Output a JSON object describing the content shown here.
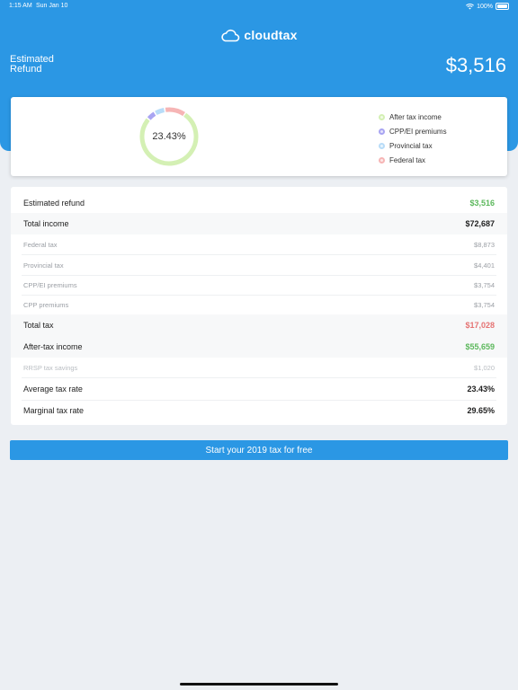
{
  "status_bar": {
    "time": "1:15 AM",
    "date": "Sun Jan 10",
    "battery": "100%"
  },
  "header": {
    "brand": "cloudtax",
    "refund_label": "Estimated Refund",
    "refund_amount": "$3,516"
  },
  "chart_data": {
    "type": "pie",
    "center_label": "23.43%",
    "series": [
      {
        "name": "After tax income",
        "value": 55659,
        "color": "#d4f0b4"
      },
      {
        "name": "CPP/EI premiums",
        "value": 3754,
        "color": "#a9a5f2"
      },
      {
        "name": "Provincial tax",
        "value": 4401,
        "color": "#b8dcf8"
      },
      {
        "name": "Federal tax",
        "value": 8873,
        "color": "#f6b5b5"
      }
    ]
  },
  "summary": {
    "rows": [
      {
        "label": "Estimated refund",
        "value": "$3,516"
      },
      {
        "label": "Total income",
        "value": "$72,687"
      },
      {
        "label": "Federal tax",
        "value": "$8,873"
      },
      {
        "label": "Provincial tax",
        "value": "$4,401"
      },
      {
        "label": "CPP/EI premiums",
        "value": "$3,754"
      },
      {
        "label": "CPP premiums",
        "value": "$3,754"
      },
      {
        "label": "Total tax",
        "value": "$17,028"
      },
      {
        "label": "After-tax income",
        "value": "$55,659"
      },
      {
        "label": "RRSP tax savings",
        "value": "$1,020"
      },
      {
        "label": "Average tax rate",
        "value": "23.43%"
      },
      {
        "label": "Marginal tax rate",
        "value": "29.65%"
      }
    ]
  },
  "colors": {
    "accent": "#2b97e4",
    "positive": "#5cb85c",
    "negative": "#e57373"
  },
  "cta": {
    "label": "Start your 2019 tax for free"
  }
}
